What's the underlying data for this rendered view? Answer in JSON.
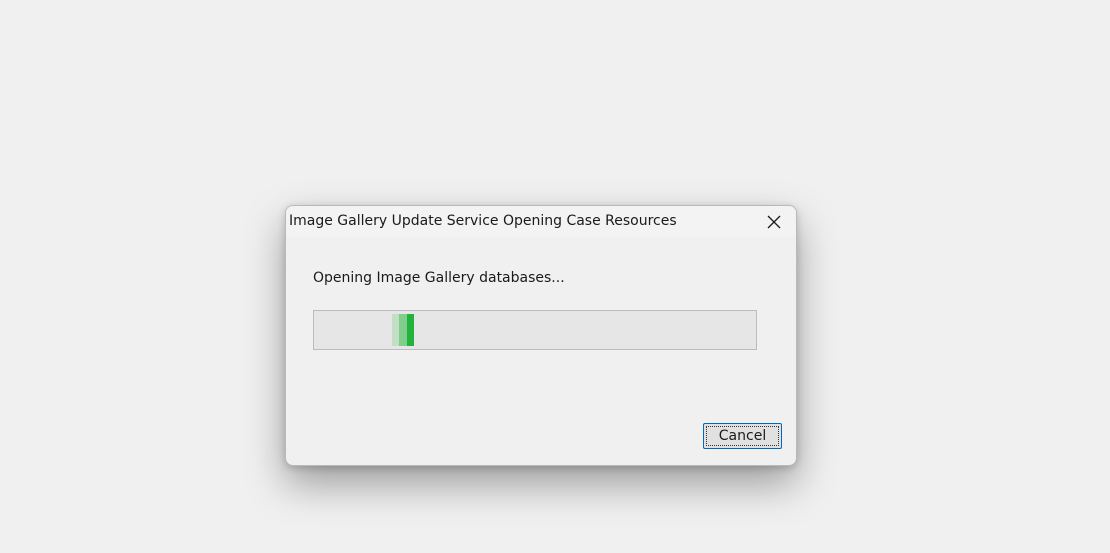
{
  "dialog": {
    "title": "Image Gallery Update Service Opening Case Resources",
    "close_icon": "close-icon",
    "message": "Opening Image Gallery databases...",
    "progress": {
      "style": "marquee",
      "indeterminate": true,
      "colors": {
        "track": "#e6e6e6",
        "fill": "#22b33c",
        "fill_mid": "#7fce8c",
        "fill_light": "#c2dfc6"
      }
    },
    "cancel_label": "Cancel",
    "accent_color": "#0067c0"
  }
}
